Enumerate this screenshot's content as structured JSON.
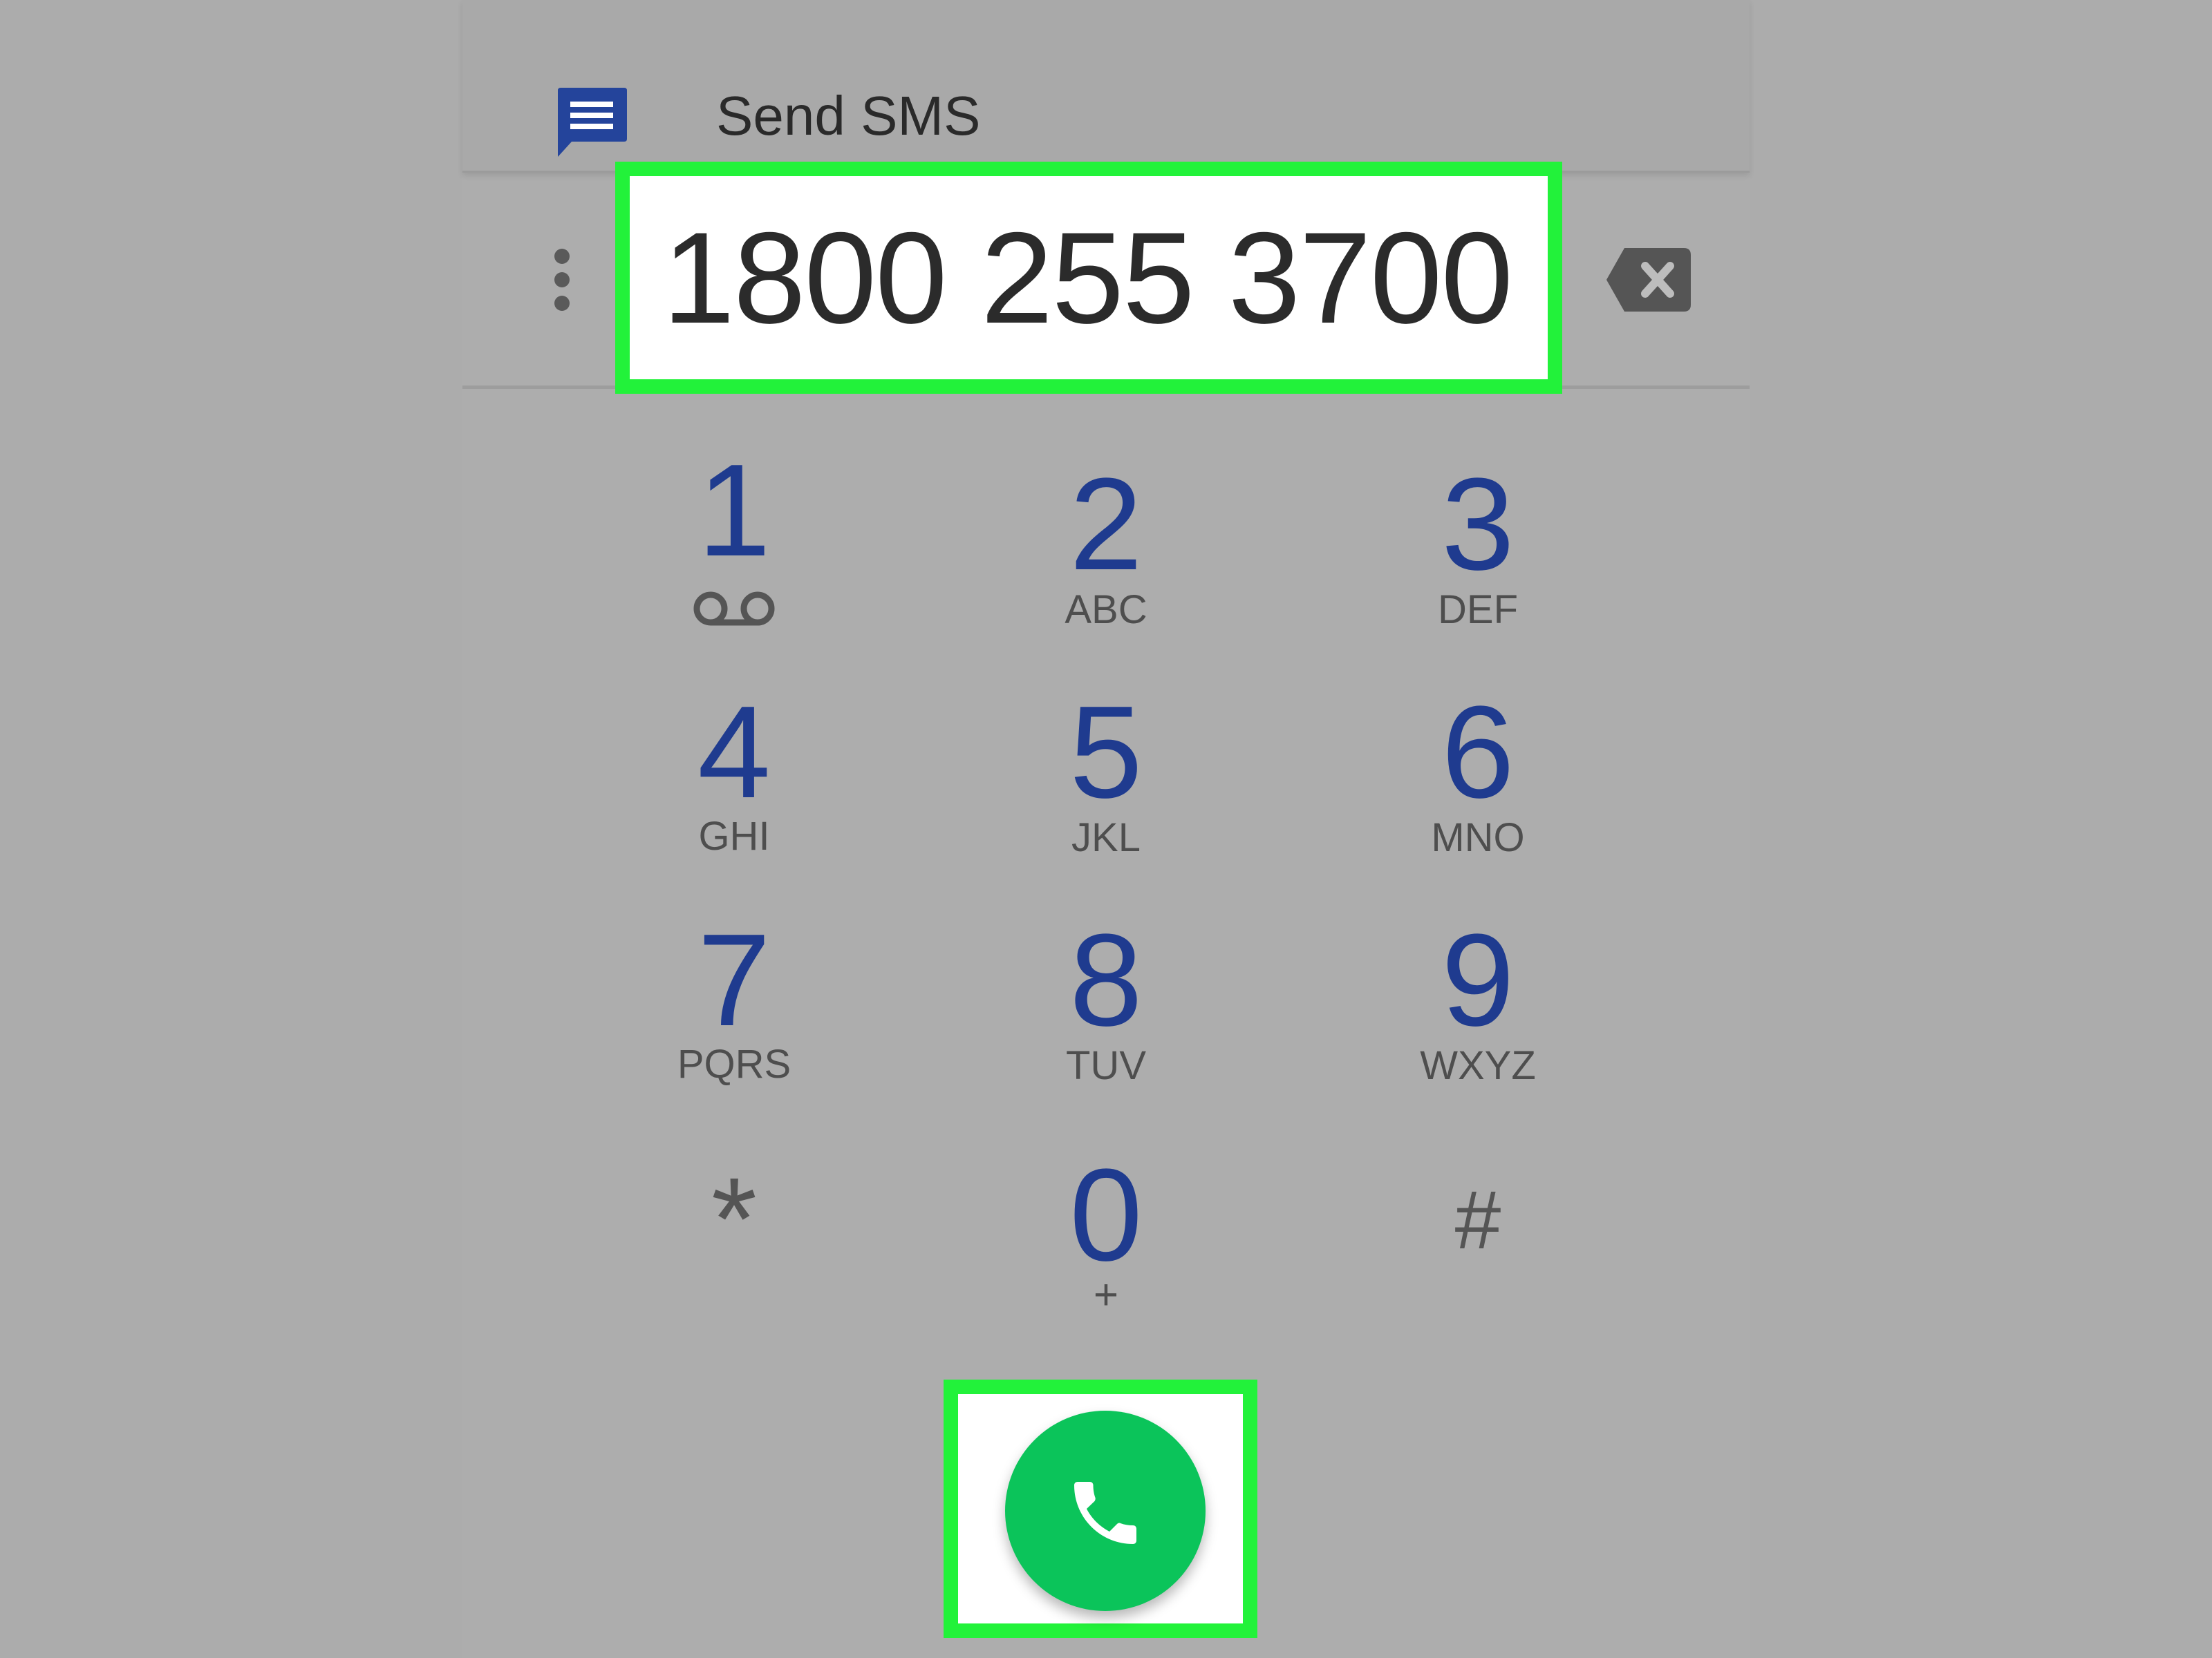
{
  "sms": {
    "label": "Send SMS",
    "icon": "message-icon"
  },
  "dialer": {
    "number": "1800 255 3700",
    "overflow_icon": "more-vert-icon",
    "backspace_icon": "backspace-icon"
  },
  "keypad": {
    "keys": [
      {
        "digit": "1",
        "letters": "",
        "icon": "voicemail-icon"
      },
      {
        "digit": "2",
        "letters": "ABC"
      },
      {
        "digit": "3",
        "letters": "DEF"
      },
      {
        "digit": "4",
        "letters": "GHI"
      },
      {
        "digit": "5",
        "letters": "JKL"
      },
      {
        "digit": "6",
        "letters": "MNO"
      },
      {
        "digit": "7",
        "letters": "PQRS"
      },
      {
        "digit": "8",
        "letters": "TUV"
      },
      {
        "digit": "9",
        "letters": "WXYZ"
      },
      {
        "digit": "*",
        "letters": ""
      },
      {
        "digit": "0",
        "letters": "+"
      },
      {
        "digit": "#",
        "letters": ""
      }
    ]
  },
  "call": {
    "icon": "phone-icon"
  },
  "colors": {
    "highlight": "#22f23a",
    "digit": "#1f3b8f",
    "call_button": "#0bc45a",
    "sms_icon": "#24449b"
  }
}
